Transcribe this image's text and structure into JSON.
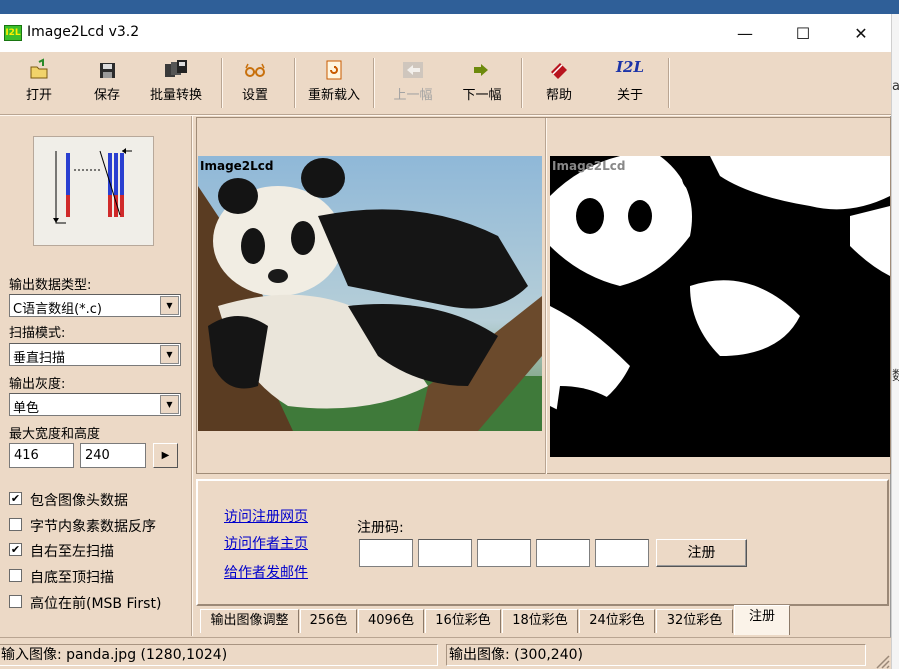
{
  "window": {
    "title": "Image2Lcd v3.2",
    "icon_text": "I2L",
    "minimize_glyph": "—",
    "maximize_glyph": "☐",
    "close_glyph": "✕"
  },
  "toolbar": {
    "open": "打开",
    "save": "保存",
    "batch": "批量转换",
    "settings": "设置",
    "reload": "重新载入",
    "prev": "上一幅",
    "next": "下一幅",
    "help": "帮助",
    "about": "关于",
    "about_icon_text": "I2L"
  },
  "left_panel": {
    "output_type_label": "输出数据类型:",
    "output_type_value": "C语言数组(*.c)",
    "scan_mode_label": "扫描模式:",
    "scan_mode_value": "垂直扫描",
    "gray_label": "输出灰度:",
    "gray_value": "单色",
    "max_size_label": "最大宽度和高度",
    "width": "416",
    "height": "240",
    "arrow_glyph": "▶",
    "dropdown_glyph": "▼",
    "checkboxes": [
      {
        "label": "包含图像头数据",
        "checked": true
      },
      {
        "label": "字节内象素数据反序",
        "checked": false
      },
      {
        "label": "自右至左扫描",
        "checked": true
      },
      {
        "label": "自底至顶扫描",
        "checked": false
      },
      {
        "label": "高位在前(MSB First)",
        "checked": false
      }
    ]
  },
  "images": {
    "original_watermark": "Image2Lcd",
    "preview_watermark": "Image2Lcd"
  },
  "register": {
    "link_visit_register": "访问注册网页",
    "link_author_home": "访问作者主页",
    "link_email_author": "给作者发邮件",
    "code_label": "注册码:",
    "register_button": "注册",
    "codes": [
      "",
      "",
      "",
      "",
      ""
    ]
  },
  "tabs": [
    {
      "label": "输出图像调整",
      "active": false
    },
    {
      "label": "256色",
      "active": false
    },
    {
      "label": "4096色",
      "active": false
    },
    {
      "label": "16位彩色",
      "active": false
    },
    {
      "label": "18位彩色",
      "active": false
    },
    {
      "label": "24位彩色",
      "active": false
    },
    {
      "label": "32位彩色",
      "active": false
    },
    {
      "label": "注册",
      "active": true
    }
  ],
  "status": {
    "input": "输入图像: panda.jpg (1280,1024)",
    "output": "输出图像: (300,240)"
  },
  "background": {
    "side_text_top": "a",
    "side_text_mid": "数"
  }
}
